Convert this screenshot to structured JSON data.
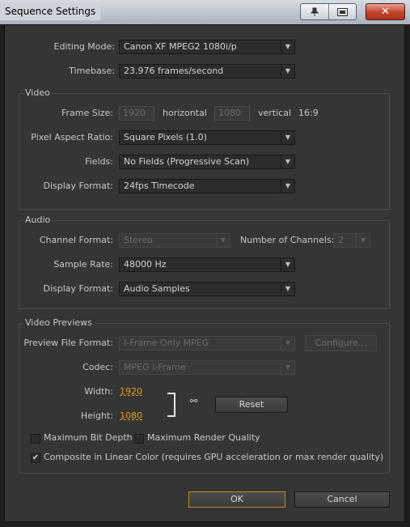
{
  "window": {
    "title": "Sequence Settings",
    "pin_icon": "pin-icon",
    "restore_icon": "restore-icon",
    "close_label": "✕"
  },
  "general": {
    "editing_mode_label": "Editing Mode:",
    "editing_mode_value": "Canon XF MPEG2 1080i/p",
    "timebase_label": "Timebase:",
    "timebase_value": "23.976 frames/second"
  },
  "video": {
    "group_title": "Video",
    "frame_size_label": "Frame Size:",
    "frame_width": "1920",
    "horizontal_label": "horizontal",
    "frame_height": "1080",
    "vertical_label": "vertical",
    "aspect": "16:9",
    "par_label": "Pixel Aspect Ratio:",
    "par_value": "Square Pixels (1.0)",
    "fields_label": "Fields:",
    "fields_value": "No Fields (Progressive Scan)",
    "display_format_label": "Display Format:",
    "display_format_value": "24fps Timecode"
  },
  "audio": {
    "group_title": "Audio",
    "channel_format_label": "Channel Format:",
    "channel_format_value": "Stereo",
    "num_channels_label": "Number of Channels:",
    "num_channels_value": "2",
    "sample_rate_label": "Sample Rate:",
    "sample_rate_value": "48000 Hz",
    "display_format_label": "Display Format:",
    "display_format_value": "Audio Samples"
  },
  "previews": {
    "group_title": "Video Previews",
    "preview_format_label": "Preview File Format:",
    "preview_format_value": "I-Frame Only MPEG",
    "configure_label": "Configure...",
    "codec_label": "Codec:",
    "codec_value": "MPEG I-Frame",
    "width_label": "Width:",
    "width_value": "1920",
    "height_label": "Height:",
    "height_value": "1080",
    "link_icon": "chain-link-icon",
    "reset_label": "Reset",
    "max_bit_depth_label": "Maximum Bit Depth",
    "max_bit_depth_checked": false,
    "max_render_quality_label": "Maximum Render Quality",
    "max_render_quality_checked": false,
    "composite_linear_label": "Composite in Linear Color (requires GPU acceleration or max render quality)",
    "composite_linear_checked": true
  },
  "footer": {
    "ok_label": "OK",
    "cancel_label": "Cancel"
  },
  "colors": {
    "accent_orange": "#e3a01b",
    "panel_bg": "#353535",
    "close_red": "#c0412b"
  }
}
